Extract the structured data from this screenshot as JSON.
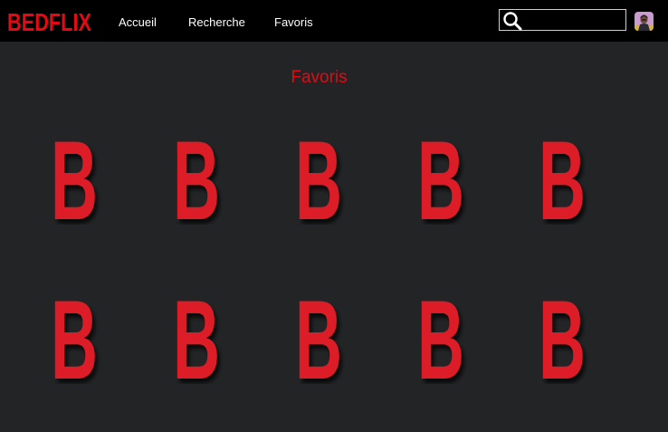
{
  "header": {
    "logo_text": "BEDFLIX",
    "nav": [
      {
        "label": "Accueil"
      },
      {
        "label": "Recherche"
      },
      {
        "label": "Favoris"
      }
    ],
    "search": {
      "placeholder": "",
      "value": "",
      "icon": "search-icon"
    },
    "avatar": {
      "icon": "avatar-icon"
    }
  },
  "main": {
    "title": "Favoris",
    "favorites": [
      {
        "poster_letter": "B"
      },
      {
        "poster_letter": "B"
      },
      {
        "poster_letter": "B"
      },
      {
        "poster_letter": "B"
      },
      {
        "poster_letter": "B"
      },
      {
        "poster_letter": "B"
      },
      {
        "poster_letter": "B"
      },
      {
        "poster_letter": "B"
      },
      {
        "poster_letter": "B"
      },
      {
        "poster_letter": "B"
      }
    ]
  },
  "colors": {
    "brand_red": "#e50914",
    "poster_red": "#dc1f26",
    "background": "#222426",
    "topbar": "#000000"
  }
}
